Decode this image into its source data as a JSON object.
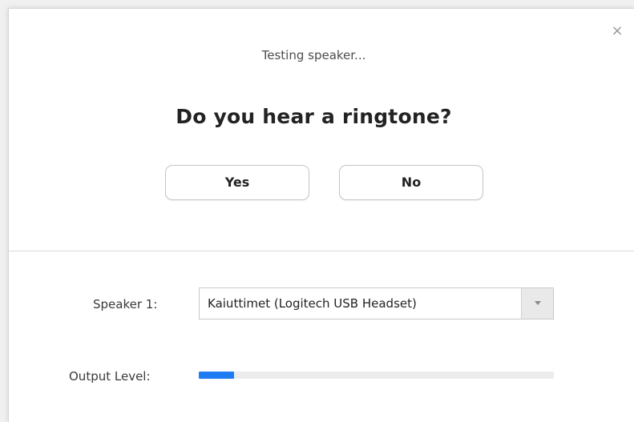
{
  "dialog": {
    "status_text": "Testing speaker...",
    "question": "Do you hear a ringtone?",
    "buttons": {
      "yes": "Yes",
      "no": "No"
    },
    "close_icon": "close-icon"
  },
  "speaker": {
    "label": "Speaker 1:",
    "selected": "Kaiuttimet (Logitech USB Headset)",
    "dropdown_icon": "chevron-down-icon"
  },
  "output": {
    "label": "Output Level:",
    "level_fraction": 0.1
  },
  "colors": {
    "accent": "#1f7bf1",
    "meter_track": "#ececec"
  }
}
